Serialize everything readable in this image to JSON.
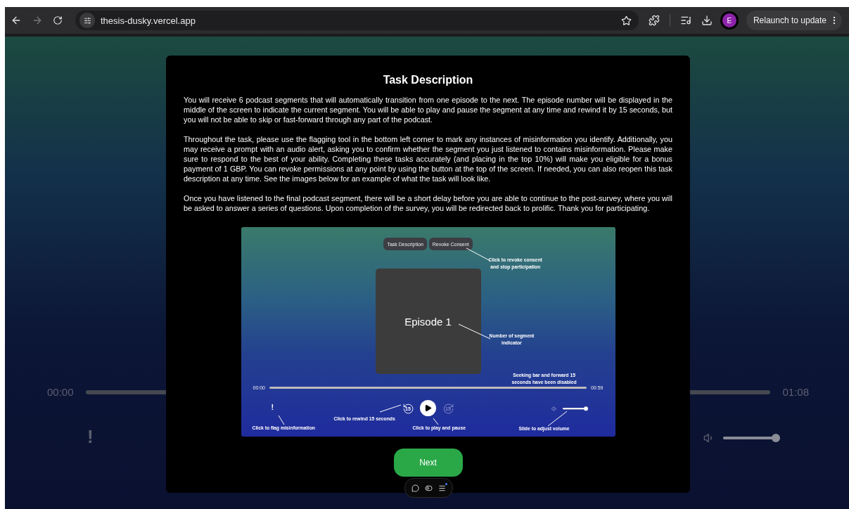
{
  "browser": {
    "url": "thesis-dusky.vercel.app",
    "profile": "E",
    "relaunch": "Relaunch to update",
    "forward_disabled": true
  },
  "player": {
    "elapsed": "00:00",
    "total": "01:08",
    "flag": "!",
    "volume": {
      "level": 1
    }
  },
  "modal": {
    "title": "Task Description",
    "paragraphs": [
      "You will receive 6 podcast segments that will automatically transition from one episode to the next. The episode number will be displayed in the middle of the screen to indicate the current segment. You will be able to play and pause the segment at any time and rewind it by 15 seconds, but you will not be able to skip or fast-forward through any part of the podcast.",
      "Throughout the task, please use the flagging tool in the bottom left corner to mark any instances of misinformation you identify. Additionally, you may receive a prompt with an audio alert, asking you to confirm whether the segment you just listened to contains misinformation. Please make sure to respond to the best of your ability. Completing these tasks accurately (and placing in the top 10%) will make you eligible for a bonus payment of 1 GBP. You can revoke permissions at any point by using the button at the top of the screen. If needed, you can also reopen this task description at any time. See the images below for an example of what the task will look like.",
      "Once you have listened to the final podcast segment, there will be a short delay before you are able to continue to the post-survey, where you will be asked to answer a series of questions. Upon completion of the survey, you will be redirected back to prolific. Thank you for participating."
    ],
    "example": {
      "buttons": [
        "Task Description",
        "Revoke Consent"
      ],
      "episode": "Episode 1",
      "elapsed": "00:00",
      "total": "00:59",
      "flag": "!",
      "rewind": {
        "label": "15",
        "disabled": false
      },
      "forward": {
        "label": "15",
        "disabled": true
      },
      "volume": {
        "level": 1
      },
      "annotations": [
        "Click to revoke consent\nand stop participation",
        "Number of segment\nindicator",
        "Seeking bar and forward 15\nseconds have been disabled",
        "Click to flag misinformation",
        "Click to rewind 15 seconds",
        "Click to play and pause",
        "Slide to adjust volume"
      ]
    },
    "next_button": "Next"
  }
}
